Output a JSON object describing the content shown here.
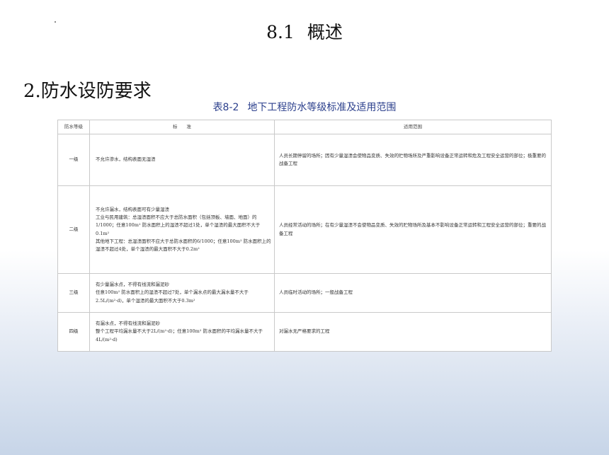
{
  "title": {
    "number": "8.1",
    "text": "概述"
  },
  "section_heading": "2.防水设防要求",
  "table_caption": {
    "number": "表8-2",
    "text": "地下工程防水等级标准及适用范围"
  },
  "table": {
    "headers": [
      "防水等级",
      "标　　准",
      "适用范围"
    ],
    "rows": [
      {
        "grade": "一级",
        "standard": [
          "不允许渗水，结构表面无湿渍"
        ],
        "scope": "人员长期停留的场所；因有少量湿渍会使物品变质、失效的贮物场所及严重影响设备正常运转和危及工程安全运营的部位；极重要的战备工程"
      },
      {
        "grade": "二级",
        "standard": [
          "不允许漏水，结构表面可有少量湿渍",
          "工业与民用建筑：总湿渍面积不应大于总防水面积（包括顶板、墙面、地面）的1/1000；任意100m² 防水面积上的湿渍不超过1处，单个湿渍的最大面积不大于0.1m²",
          "其他地下工程：总湿渍面积不应大于总防水面积的6/1000；任意100m² 防水面积上的湿渍不超过4处，单个湿渍的最大面积不大于0.2m²"
        ],
        "scope": "人员经常活动的场所；在有少量湿渍不会使物品变质、失效的贮物场所及基本不影响设备正常运转和工程安全运营的部位；重要的战备工程"
      },
      {
        "grade": "三级",
        "standard": [
          "有少量漏水点，不得有线流和漏泥砂",
          "任意100m² 防水面积上的湿渍不超过7处，单个漏水点的最大漏水量不大于2.5L/(m²·d)，单个湿渍的最大面积不大于0.3m²"
        ],
        "scope": "人员临时活动的场所；一般战备工程"
      },
      {
        "grade": "四级",
        "standard": [
          "有漏水点，不得有线流和漏泥砂",
          "整个工程平均漏水量不大于2L/(m²·d)；任意100m² 防水面积的平均漏水量不大于4L/(m²·d)"
        ],
        "scope": "对漏水无严格要求的工程"
      }
    ]
  }
}
